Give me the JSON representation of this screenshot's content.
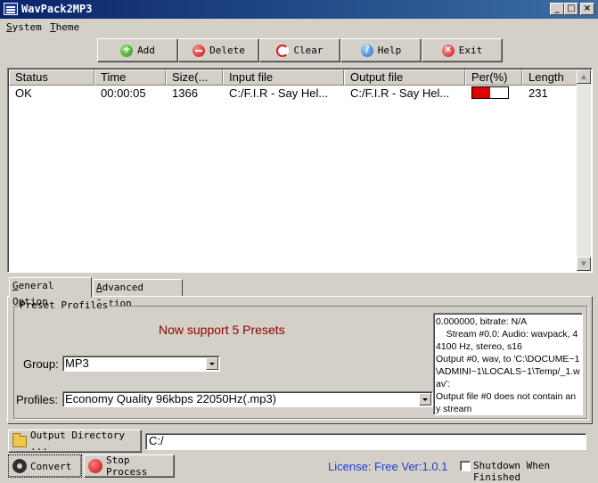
{
  "window": {
    "title": "WavPack2MP3"
  },
  "menu": [
    {
      "label": "System",
      "u": "S",
      "rest": "ystem"
    },
    {
      "label": "Theme",
      "u": "T",
      "rest": "heme"
    }
  ],
  "toolbar": {
    "add": "Add",
    "delete": "Delete",
    "clear": "Clear",
    "help": "Help",
    "exit": "Exit"
  },
  "list": {
    "columns": [
      "Status",
      "Time",
      "Size(...",
      "Input file",
      "Output file",
      "Per(%)",
      "Length"
    ],
    "rows": [
      {
        "status": "OK",
        "time": "00:00:05",
        "size": "1366",
        "input": "C:/F.I.R - Say Hel...",
        "output": "C:/F.I.R - Say Hel...",
        "per": 0.5,
        "length": "231"
      }
    ]
  },
  "tabs": {
    "general": {
      "u": "G",
      "rest": "eneral Option"
    },
    "advanced": {
      "u": "A",
      "rest": "dvanced Option"
    }
  },
  "presets": {
    "title": "Preset Profiles",
    "promo": "Now support 5 Presets",
    "group_label": "Group:",
    "group_value": "MP3",
    "profiles_label": "Profiles:",
    "profiles_value": "Economy Quality 96kbps 22050Hz(.mp3)"
  },
  "log": [
    "0.000000, bitrate: N/A",
    "    Stream #0.0: Audio: wavpack, 44100 Hz, stereo, s16",
    "Output #0, wav, to 'C:\\DOCUME~1\\ADMINI~1\\LOCALS~1\\Temp/_1.wav':",
    "Output file #0 does not contain any stream"
  ],
  "bottom": {
    "output_dir_button": "Output Directory ...",
    "output_dir_value": "C:/",
    "convert": "Convert",
    "stop": "Stop Process",
    "license": "License: Free Ver:1.0.1",
    "shutdown": "Shutdown When Finished"
  },
  "colors": {
    "accent": "#0a246a",
    "progress": "#e00000",
    "promo": "#8b0000",
    "license": "#1d3fd3"
  }
}
